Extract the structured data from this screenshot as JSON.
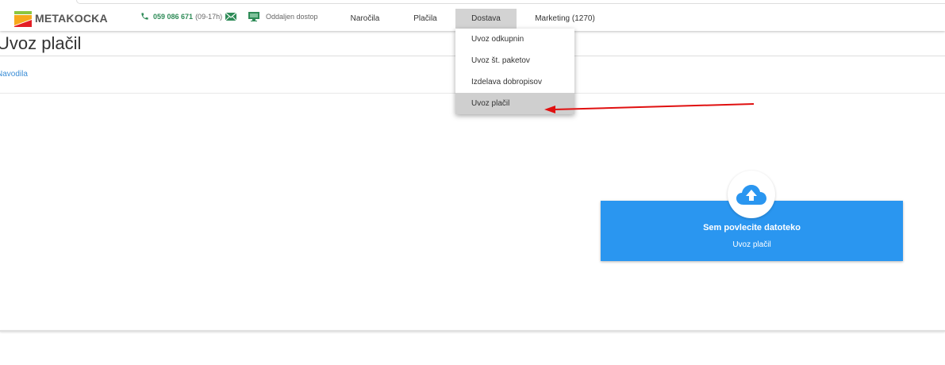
{
  "header": {
    "logo_text": "METAKOCKA",
    "phone": "059 086 671",
    "phone_hours": "(09-17h)",
    "remote_label": "Oddaljen dostop",
    "nav": [
      "Naročila",
      "Plačila",
      "Dostava",
      "Marketing (1270)"
    ],
    "active_nav": "Dostava"
  },
  "dropdown": {
    "items": [
      "Uvoz odkupnin",
      "Uvoz št. paketov",
      "Izdelava dobropisov",
      "Uvoz plačil"
    ],
    "selected": "Uvoz plačil"
  },
  "page": {
    "title": "Uvoz plačil",
    "help_link": "Navodila"
  },
  "upload": {
    "title": "Sem povlecite datoteko",
    "subtitle": "Uvoz plačil"
  },
  "colors": {
    "accent_blue": "#2a96f0",
    "phone_green": "#2e8b57",
    "annotation_red": "#e01010"
  }
}
